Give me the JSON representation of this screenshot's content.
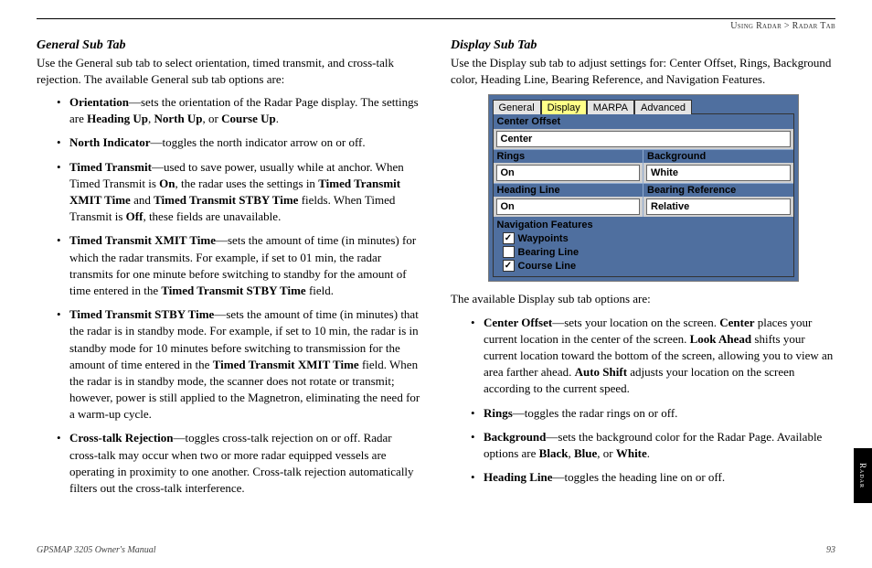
{
  "breadcrumb": {
    "left": "Using Radar",
    "sep": " > ",
    "right": "Radar Tab"
  },
  "side_tab": "Radar",
  "footer": {
    "manual": "GPSMAP 3205 Owner's Manual",
    "page": "93"
  },
  "left": {
    "heading": "General Sub Tab",
    "intro": "Use the General sub tab to select orientation, timed transmit, and cross-talk rejection. The available General sub tab options are:",
    "items": [
      {
        "term": "Orientation",
        "rest": "—sets the orientation of the Radar Page display. The settings are ",
        "b1": "Heading Up",
        "c1": ", ",
        "b2": "North Up",
        "c2": ", or ",
        "b3": "Course Up",
        "end": "."
      },
      {
        "term": "North Indicator",
        "rest": "—toggles the north indicator arrow on or off."
      },
      {
        "term": "Timed Transmit",
        "rest": "—used to save power, usually while at anchor. When Timed Transmit is ",
        "b1": "On",
        "c1": ", the radar uses the settings in ",
        "b2": "Timed Transmit XMIT Time",
        "c2": " and ",
        "b3": "Timed Transmit STBY Time",
        "c3": " fields. When Timed Transmit is ",
        "b4": "Off",
        "end": ", these fields are unavailable."
      },
      {
        "term": "Timed Transmit XMIT Time",
        "rest": "—sets the amount of time (in minutes) for which the radar transmits. For example, if set to 01 min, the radar transmits for one minute before switching to standby for the amount of time entered in the ",
        "b1": "Timed Transmit STBY Time",
        "end": " field."
      },
      {
        "term": "Timed Transmit STBY Time",
        "rest": "—sets the amount of time (in minutes) that the radar is in standby mode. For example, if set to 10 min, the radar is in standby mode for 10 minutes before switching to transmission for the amount of time entered in the ",
        "b1": "Timed Transmit XMIT Time",
        "end": " field. When the radar is in standby mode, the scanner does not rotate or transmit; however, power is still applied to the Magnetron, eliminating the need for a warm-up cycle."
      },
      {
        "term": "Cross-talk Rejection",
        "rest": "—toggles cross-talk rejection on or off. Radar cross-talk may occur when two or more radar equipped vessels are operating in proximity to one another. Cross-talk rejection automatically filters out the cross-talk interference."
      }
    ]
  },
  "right": {
    "heading": "Display Sub Tab",
    "intro": "Use the Display sub tab to adjust settings for: Center Offset, Rings, Background color, Heading Line, Bearing Reference, and Navigation Features.",
    "caption": "The available Display sub tab options are:",
    "items": [
      {
        "term": "Center Offset",
        "rest": "—sets your location on the screen. ",
        "b1": "Center",
        "c1": " places your current location in the center of the screen. ",
        "b2": "Look Ahead",
        "c2": " shifts your current location toward the bottom of the screen, allowing you to view an area farther ahead. ",
        "b3": "Auto Shift",
        "end": " adjusts your location on the screen according to the current speed."
      },
      {
        "term": "Rings",
        "rest": "—toggles the radar rings on or off."
      },
      {
        "term": "Background",
        "rest": "—sets the background color for the Radar Page. Available options are ",
        "b1": "Black",
        "c1": ", ",
        "b2": "Blue",
        "c2": ", or ",
        "b3": "White",
        "end": "."
      },
      {
        "term": "Heading Line",
        "rest": "—toggles the heading line on or off."
      }
    ]
  },
  "ui": {
    "tabs": [
      "General",
      "Display",
      "MARPA",
      "Advanced"
    ],
    "active_tab": 1,
    "fields": {
      "center_offset_label": "Center Offset",
      "center_offset_value": "Center",
      "rings_label": "Rings",
      "rings_value": "On",
      "background_label": "Background",
      "background_value": "White",
      "heading_line_label": "Heading Line",
      "heading_line_value": "On",
      "bearing_ref_label": "Bearing Reference",
      "bearing_ref_value": "Relative",
      "nav_features_label": "Navigation Features",
      "waypoints": {
        "label": "Waypoints",
        "checked": true
      },
      "bearing_line": {
        "label": "Bearing Line",
        "checked": false
      },
      "course_line": {
        "label": "Course Line",
        "checked": true
      }
    }
  }
}
